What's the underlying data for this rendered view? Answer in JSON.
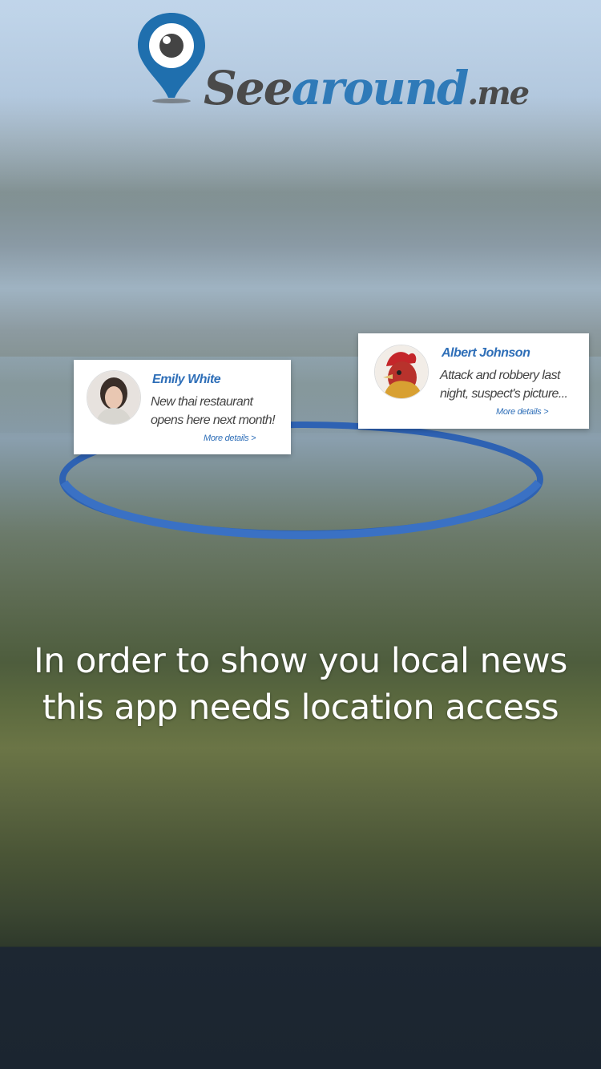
{
  "logo": {
    "text_see": "See",
    "text_around": "around",
    "text_me": ".me",
    "icon": "map-pin-eye-icon",
    "colors": {
      "brand_blue": "#2f7ab8",
      "brand_gray": "#4a4a4a"
    }
  },
  "cards": [
    {
      "name": "Emily White",
      "message_line1": "New thai restaurant",
      "message_line2": "opens here next month!",
      "more": "More details >",
      "avatar": "woman-portrait-avatar"
    },
    {
      "name": "Albert Johnson",
      "message_line1": "Attack and robbery last",
      "message_line2": "night, suspect's picture...",
      "more": "More details >",
      "avatar": "rooster-portrait-avatar"
    }
  ],
  "headline": {
    "line1": "In order to show you local news",
    "line2": "this app needs location access"
  },
  "colors": {
    "accent": "#2f6fb8",
    "ring": "#2e62b3"
  }
}
